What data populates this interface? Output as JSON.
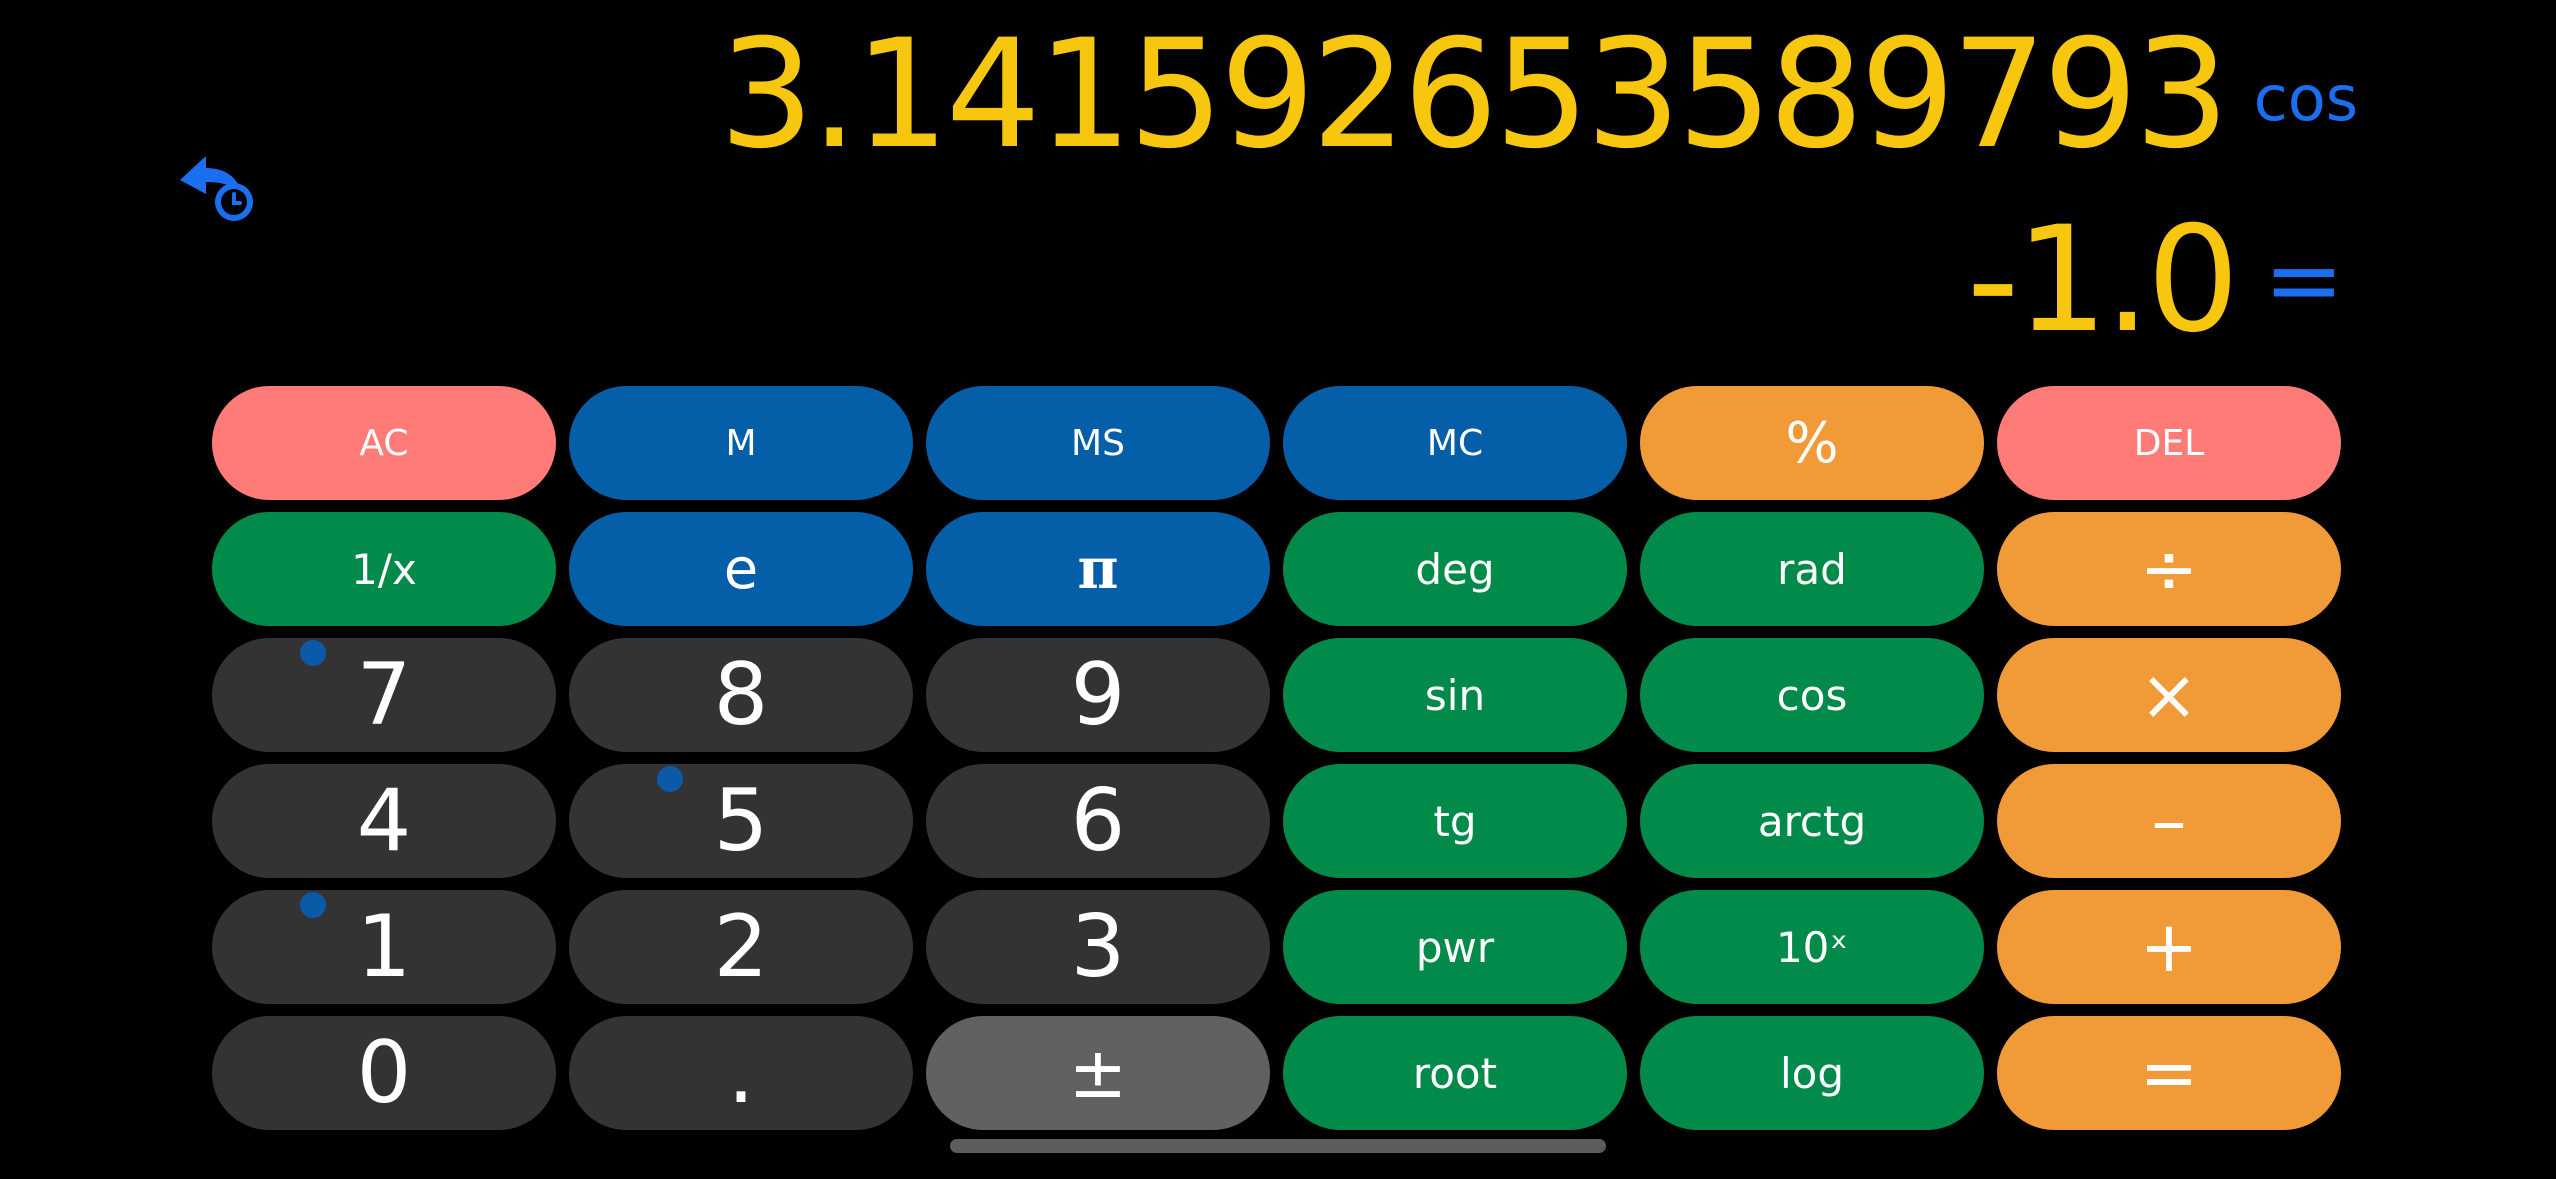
{
  "display": {
    "expression": "3.141592653589793",
    "operation": "cos",
    "result": "-1.0",
    "equals_sign": "="
  },
  "history_icon": "history-undo-icon",
  "colors": {
    "background": "#000000",
    "display_value": "#f7c70f",
    "display_accent": "#1a6ff0",
    "key_red": "#ff7b78",
    "key_blue": "#055ea8",
    "key_green": "#028a4a",
    "key_orange": "#f19b38",
    "key_dark": "#333333",
    "key_gray": "#616161"
  },
  "keys": {
    "row1": [
      "AC",
      "M",
      "MS",
      "MC",
      "%",
      "DEL"
    ],
    "row2": [
      "1/x",
      "e",
      "π",
      "deg",
      "rad",
      "÷"
    ],
    "row3": [
      "7",
      "8",
      "9",
      "sin",
      "cos",
      "×"
    ],
    "row4": [
      "4",
      "5",
      "6",
      "tg",
      "arctg",
      "–"
    ],
    "row5": [
      "1",
      "2",
      "3",
      "pwr",
      "10ˣ",
      "+"
    ],
    "row6": [
      "0",
      ".",
      "±",
      "root",
      "log",
      "="
    ]
  }
}
